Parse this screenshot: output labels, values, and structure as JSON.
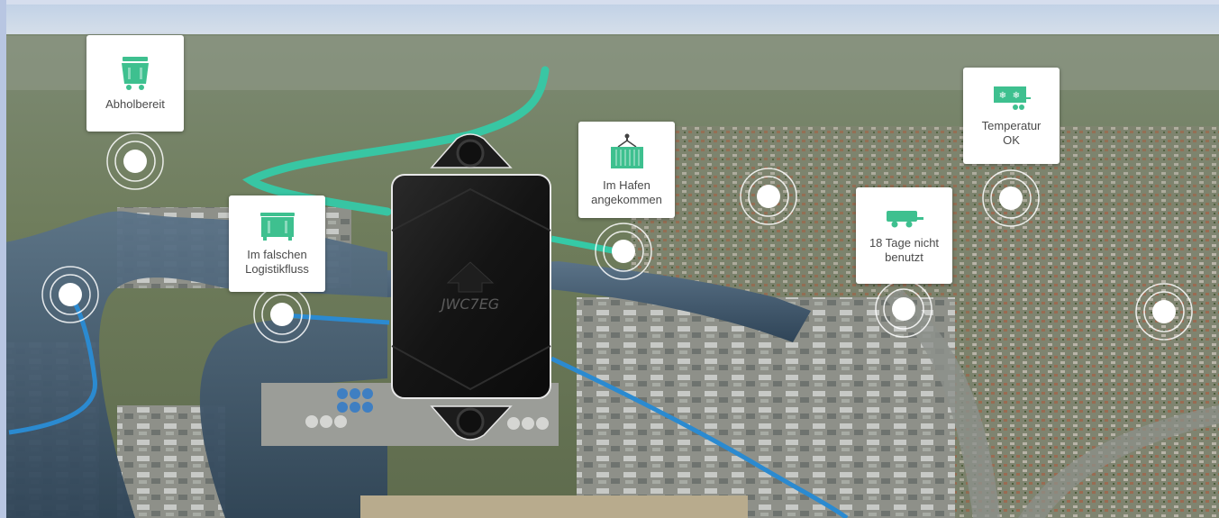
{
  "cards": [
    {
      "icon": "container-bin-icon",
      "label": "Abholbereit"
    },
    {
      "icon": "container-bin-icon",
      "label": "Im falschen Logistikfluss"
    },
    {
      "icon": "crane-container-icon",
      "label": "Im Hafen angekommen"
    },
    {
      "icon": "trailer-icon",
      "label": "18 Tage nicht benutzt"
    },
    {
      "icon": "refrigerated-trailer-icon",
      "label": "Temperatur OK"
    }
  ],
  "tracker": {
    "code": "JWC7EG"
  },
  "colors": {
    "accent_green": "#3ec08f",
    "route_teal": "#35c9a6",
    "route_blue": "#2b8ad0",
    "card_bg": "#ffffff",
    "marker": "#ffffff"
  }
}
